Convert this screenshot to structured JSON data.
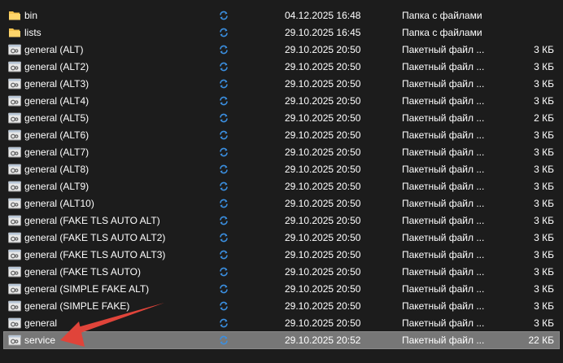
{
  "files": [
    {
      "name": "bin",
      "kind": "folder",
      "icon": "folder-icon",
      "sync_icon": "sync-icon",
      "date": "04.12.2025 16:48",
      "type": "Папка с файлами",
      "size": ""
    },
    {
      "name": "lists",
      "kind": "folder",
      "icon": "folder-icon",
      "sync_icon": "sync-icon",
      "date": "29.10.2025 16:45",
      "type": "Папка с файлами",
      "size": ""
    },
    {
      "name": "general (ALT)",
      "kind": "batch",
      "icon": "batch-file-icon",
      "sync_icon": "sync-icon",
      "date": "29.10.2025 20:50",
      "type": "Пакетный файл ...",
      "size": "3 КБ"
    },
    {
      "name": "general (ALT2)",
      "kind": "batch",
      "icon": "batch-file-icon",
      "sync_icon": "sync-icon",
      "date": "29.10.2025 20:50",
      "type": "Пакетный файл ...",
      "size": "3 КБ"
    },
    {
      "name": "general (ALT3)",
      "kind": "batch",
      "icon": "batch-file-icon",
      "sync_icon": "sync-icon",
      "date": "29.10.2025 20:50",
      "type": "Пакетный файл ...",
      "size": "3 КБ"
    },
    {
      "name": "general (ALT4)",
      "kind": "batch",
      "icon": "batch-file-icon",
      "sync_icon": "sync-icon",
      "date": "29.10.2025 20:50",
      "type": "Пакетный файл ...",
      "size": "3 КБ"
    },
    {
      "name": "general (ALT5)",
      "kind": "batch",
      "icon": "batch-file-icon",
      "sync_icon": "sync-icon",
      "date": "29.10.2025 20:50",
      "type": "Пакетный файл ...",
      "size": "2 КБ"
    },
    {
      "name": "general (ALT6)",
      "kind": "batch",
      "icon": "batch-file-icon",
      "sync_icon": "sync-icon",
      "date": "29.10.2025 20:50",
      "type": "Пакетный файл ...",
      "size": "3 КБ"
    },
    {
      "name": "general (ALT7)",
      "kind": "batch",
      "icon": "batch-file-icon",
      "sync_icon": "sync-icon",
      "date": "29.10.2025 20:50",
      "type": "Пакетный файл ...",
      "size": "3 КБ"
    },
    {
      "name": "general (ALT8)",
      "kind": "batch",
      "icon": "batch-file-icon",
      "sync_icon": "sync-icon",
      "date": "29.10.2025 20:50",
      "type": "Пакетный файл ...",
      "size": "3 КБ"
    },
    {
      "name": "general (ALT9)",
      "kind": "batch",
      "icon": "batch-file-icon",
      "sync_icon": "sync-icon",
      "date": "29.10.2025 20:50",
      "type": "Пакетный файл ...",
      "size": "3 КБ"
    },
    {
      "name": "general (ALT10)",
      "kind": "batch",
      "icon": "batch-file-icon",
      "sync_icon": "sync-icon",
      "date": "29.10.2025 20:50",
      "type": "Пакетный файл ...",
      "size": "3 КБ"
    },
    {
      "name": "general (FAKE TLS AUTO ALT)",
      "kind": "batch",
      "icon": "batch-file-icon",
      "sync_icon": "sync-icon",
      "date": "29.10.2025 20:50",
      "type": "Пакетный файл ...",
      "size": "3 КБ"
    },
    {
      "name": "general (FAKE TLS AUTO ALT2)",
      "kind": "batch",
      "icon": "batch-file-icon",
      "sync_icon": "sync-icon",
      "date": "29.10.2025 20:50",
      "type": "Пакетный файл ...",
      "size": "3 КБ"
    },
    {
      "name": "general (FAKE TLS AUTO ALT3)",
      "kind": "batch",
      "icon": "batch-file-icon",
      "sync_icon": "sync-icon",
      "date": "29.10.2025 20:50",
      "type": "Пакетный файл ...",
      "size": "3 КБ"
    },
    {
      "name": "general (FAKE TLS AUTO)",
      "kind": "batch",
      "icon": "batch-file-icon",
      "sync_icon": "sync-icon",
      "date": "29.10.2025 20:50",
      "type": "Пакетный файл ...",
      "size": "3 КБ"
    },
    {
      "name": "general (SIMPLE FAKE ALT)",
      "kind": "batch",
      "icon": "batch-file-icon",
      "sync_icon": "sync-icon",
      "date": "29.10.2025 20:50",
      "type": "Пакетный файл ...",
      "size": "3 КБ"
    },
    {
      "name": "general (SIMPLE FAKE)",
      "kind": "batch",
      "icon": "batch-file-icon",
      "sync_icon": "sync-icon",
      "date": "29.10.2025 20:50",
      "type": "Пакетный файл ...",
      "size": "3 КБ"
    },
    {
      "name": "general",
      "kind": "batch",
      "icon": "batch-file-icon",
      "sync_icon": "sync-icon",
      "date": "29.10.2025 20:50",
      "type": "Пакетный файл ...",
      "size": "3 КБ"
    },
    {
      "name": "service",
      "kind": "batch",
      "icon": "batch-file-icon",
      "sync_icon": "sync-icon",
      "date": "29.10.2025 20:52",
      "type": "Пакетный файл ...",
      "size": "22 КБ",
      "selected": true
    }
  ],
  "colors": {
    "background": "#1c1c1c",
    "selected_row": "#777777",
    "text": "#ffffff",
    "folder": "#f4c34e",
    "sync_icon": "#3b8fe0",
    "annotation_arrow": "#e0443a"
  },
  "annotation": {
    "icon": "red-arrow-annotation",
    "points_to": "service"
  }
}
